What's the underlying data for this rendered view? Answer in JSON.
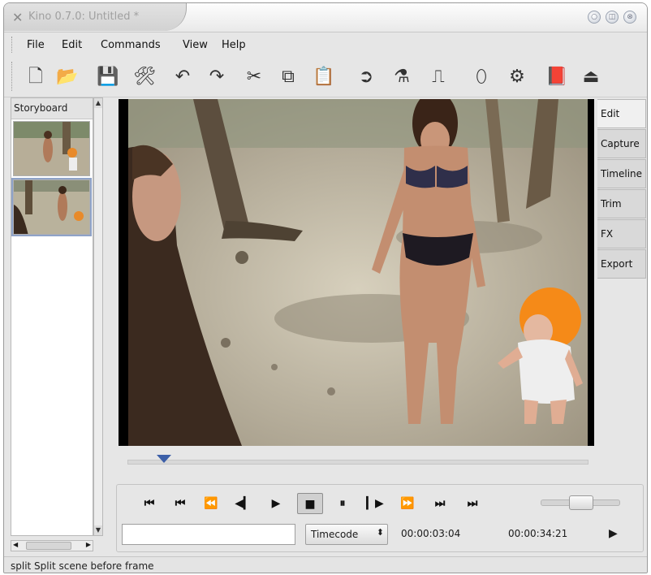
{
  "window": {
    "title": "Kino 0.7.0: Untitled *",
    "buttons": [
      "minimize-icon",
      "maximize-icon",
      "close-icon"
    ]
  },
  "menu": {
    "items": [
      {
        "label": "File",
        "mnemonic": "F"
      },
      {
        "label": "Edit",
        "mnemonic": "E"
      },
      {
        "label": "Commands",
        "mnemonic": "C"
      },
      {
        "label": "View",
        "mnemonic": "V"
      },
      {
        "label": "Help",
        "mnemonic": "H"
      }
    ]
  },
  "toolbar": {
    "tools": [
      {
        "name": "new-icon",
        "glyph": "🗋"
      },
      {
        "name": "open-icon",
        "glyph": "📂"
      },
      {
        "name": "save-icon",
        "glyph": "💾"
      },
      {
        "name": "preferences-icon",
        "glyph": "🛠"
      },
      {
        "name": "undo-icon",
        "glyph": "↶"
      },
      {
        "name": "redo-icon",
        "glyph": "↷"
      },
      {
        "name": "cut-icon",
        "glyph": "✂"
      },
      {
        "name": "copy-icon",
        "glyph": "⧉"
      },
      {
        "name": "paste-icon",
        "glyph": "📋"
      },
      {
        "name": "insert-file-icon",
        "glyph": "➲"
      },
      {
        "name": "split-scene-icon",
        "glyph": "⚗"
      },
      {
        "name": "join-scenes-icon",
        "glyph": "⎍"
      },
      {
        "name": "marker-icon",
        "glyph": "⬯"
      },
      {
        "name": "publish-icon",
        "glyph": "⚙"
      },
      {
        "name": "book-icon",
        "glyph": "📕"
      },
      {
        "name": "exit-icon",
        "glyph": "⏏"
      }
    ]
  },
  "storyboard": {
    "header": "Storyboard",
    "thumbnails": [
      "scene-1",
      "scene-2"
    ]
  },
  "tabs": [
    "Edit",
    "Capture",
    "Timeline",
    "Trim",
    "FX",
    "Export"
  ],
  "active_tab": "Edit",
  "scrubber": {
    "position": 0.08
  },
  "transport": {
    "buttons": [
      {
        "name": "start-of-movie-button",
        "glyph": "⏮"
      },
      {
        "name": "previous-scene-button",
        "glyph": "⏮"
      },
      {
        "name": "rewind-button",
        "glyph": "⏪"
      },
      {
        "name": "previous-frame-button",
        "glyph": "◀▎"
      },
      {
        "name": "play-button",
        "glyph": "▶"
      },
      {
        "name": "stop-button",
        "glyph": "■"
      },
      {
        "name": "pause-button",
        "glyph": "⏸"
      },
      {
        "name": "next-frame-button",
        "glyph": "▎▶"
      },
      {
        "name": "fast-forward-button",
        "glyph": "⏩"
      },
      {
        "name": "next-scene-button",
        "glyph": "⏭"
      },
      {
        "name": "end-of-movie-button",
        "glyph": "⏭"
      }
    ],
    "pressed": "stop-button",
    "shuttle_level": 0.5,
    "entry_value": "",
    "timecode_label": "Timecode",
    "current_time": "00:00:03:04",
    "total_time": "00:00:34:21"
  },
  "status": {
    "text": "split   Split scene before frame"
  },
  "colors": {
    "marker": "#3c5fa8",
    "hat": "#f58a18"
  }
}
